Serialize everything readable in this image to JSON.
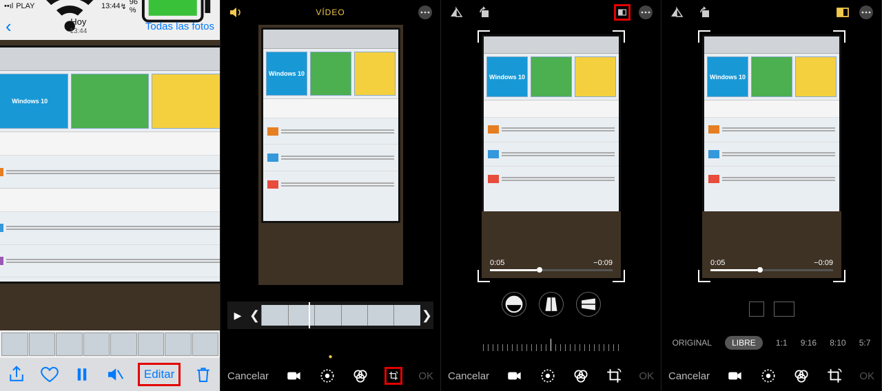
{
  "panel1": {
    "status": {
      "carrier": "PLAY",
      "wifi": "wifi-icon",
      "time": "13:44",
      "battery": "96 %",
      "battery_icon": "battery-charging"
    },
    "nav": {
      "back_icon": "chevron-left",
      "title": "Hoy",
      "subtitle": "13:44",
      "all": "Todas las fotos"
    },
    "toolbar": {
      "share": "share-icon",
      "like": "heart-icon",
      "pause": "pause-icon",
      "mute": "mute-icon",
      "edit": "Editar",
      "delete": "trash-icon"
    },
    "highlight": "edit"
  },
  "panel2": {
    "top": {
      "volume": "volume-icon",
      "title": "VÍDEO",
      "more": "more-icon"
    },
    "strip": {
      "play": "play-icon"
    },
    "bottom": {
      "cancel": "Cancelar",
      "ok": "OK",
      "tools": [
        "video",
        "adjust",
        "filters",
        "crop"
      ]
    },
    "highlight": "crop",
    "indicator_dot": "●"
  },
  "panel3": {
    "top": {
      "flip_v": "flip-v-icon",
      "rotate": "rotate-icon",
      "aspect": "aspect-icon",
      "more": "more-icon"
    },
    "time": {
      "elapsed": "0:05",
      "remaining": "−0:09"
    },
    "round_buttons": [
      "horizon",
      "flip-h",
      "skew"
    ],
    "bottom": {
      "cancel": "Cancelar",
      "ok": "OK",
      "tools": [
        "video",
        "adjust",
        "filters",
        "crop"
      ]
    },
    "highlight": "aspect"
  },
  "panel4": {
    "top": {
      "flip_v": "flip-v-icon",
      "rotate": "rotate-icon",
      "aspect": "aspect-icon",
      "more": "more-icon",
      "aspect_active": true
    },
    "time": {
      "elapsed": "0:05",
      "remaining": "−0:09"
    },
    "ratios": [
      "ORIGINAL",
      "LIBRE",
      "1:1",
      "9:16",
      "8:10",
      "5:7"
    ],
    "selected_ratio": "LIBRE",
    "bottom": {
      "cancel": "Cancelar",
      "ok": "OK",
      "tools": [
        "video",
        "adjust",
        "filters",
        "crop"
      ]
    }
  },
  "monitor": {
    "win10": "Windows 10"
  }
}
